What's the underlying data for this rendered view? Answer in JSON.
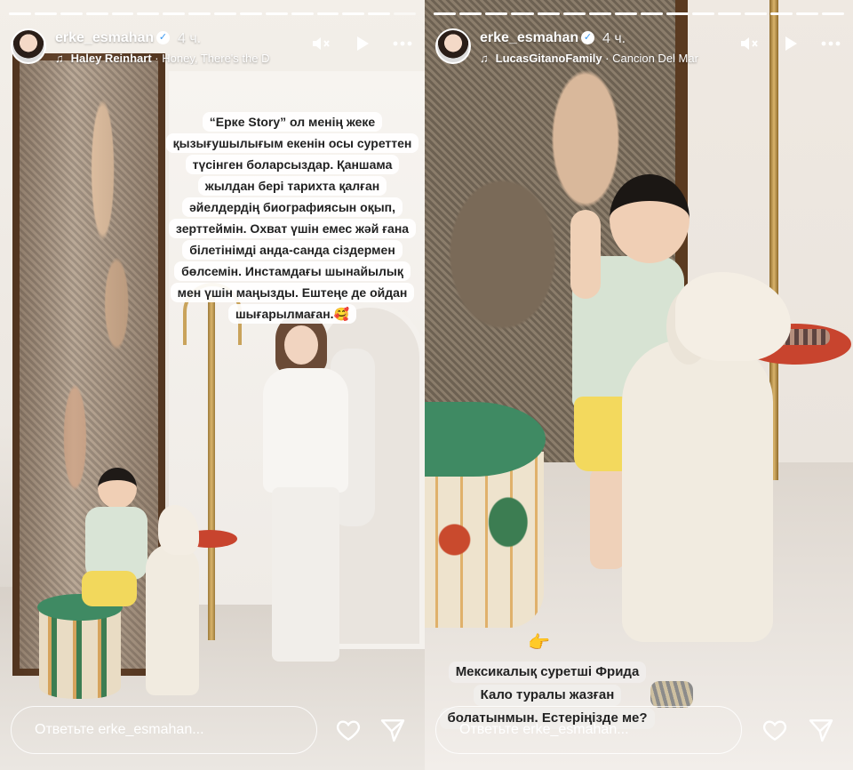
{
  "stories": [
    {
      "username": "erke_esmahan",
      "verified_mark": "✓",
      "time": "4 ч.",
      "music": {
        "artist": "Haley Reinhart",
        "track": "Honey, There's the D"
      },
      "caption_lines": [
        "“Ерке Story” ол менің жеке",
        "қызығушылығым екенін осы суреттен",
        "түсінген боларсыздар. Қаншама",
        "жылдан бері тарихта қалған",
        "әйелдердің биографиясын оқып,",
        "зерттеймін. Охват үшін емес жәй ғана",
        "білетінімді анда-санда сіздермен",
        "бөлсемін. Инстамдағы шынайылық",
        "мен үшін маңызды. Ештеңе де ойдан",
        "шығарылмаған.🥰"
      ],
      "reply_placeholder": "Ответьте erke_esmahan..."
    },
    {
      "username": "erke_esmahan",
      "verified_mark": "✓",
      "time": "4 ч.",
      "music": {
        "artist": "LucasGitanoFamily",
        "track": "Cancion Del Mar"
      },
      "caption_lines": [
        "Мексикалық суретші Фрида",
        "Кало туралы жазған",
        "болатынмын. Естеріңізде ме?"
      ],
      "sticker_emoji": "👉",
      "reply_placeholder": "Ответьте erke_esmahan..."
    }
  ],
  "icons": {
    "music": "music-note-icon",
    "mute": "speaker-muted-icon",
    "play": "play-icon",
    "more": "more-dots-icon",
    "like": "heart-icon",
    "share": "send-icon"
  },
  "colors": {
    "overlay_text": "#ffffff",
    "caption_bg": "#ffffff",
    "verified_blue": "#3897f0"
  }
}
